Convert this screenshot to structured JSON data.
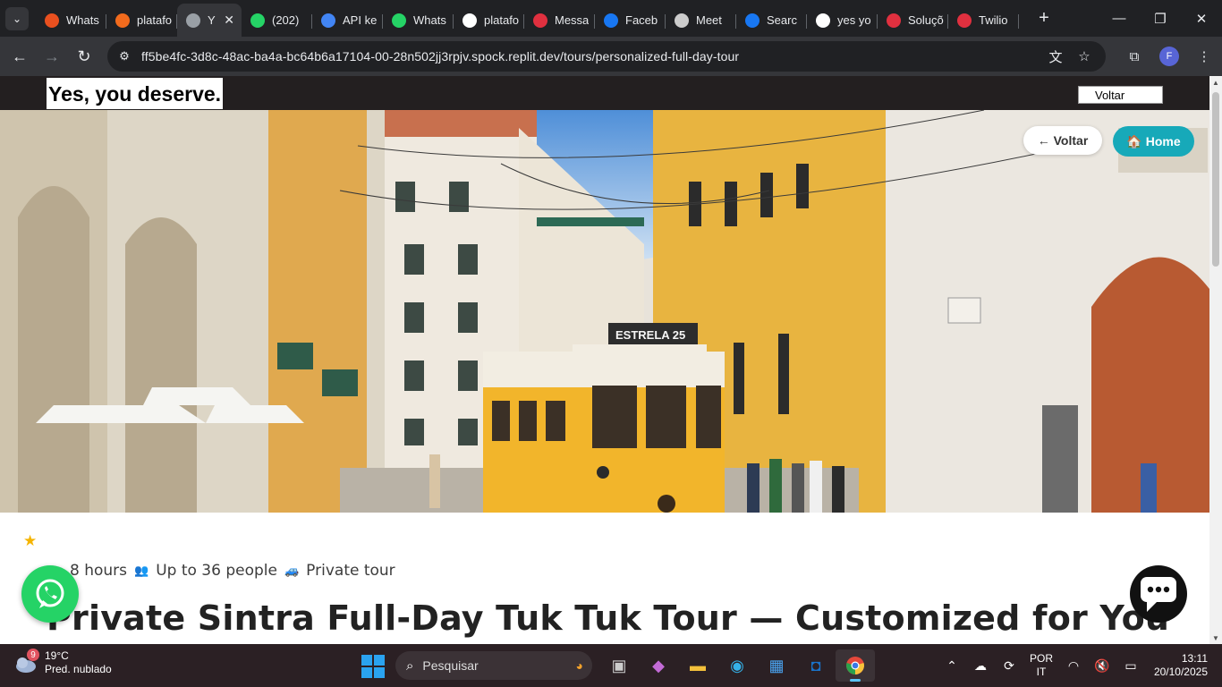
{
  "browser": {
    "tabs": [
      {
        "title": "Whats",
        "favicon": "red-circle-icon",
        "color": "#e9501f"
      },
      {
        "title": "platafo",
        "favicon": "orange-grid-icon",
        "color": "#f26b1d"
      },
      {
        "title": "Y",
        "favicon": "globe-icon",
        "color": "#9aa0a6",
        "active": true
      },
      {
        "title": "(202)",
        "favicon": "whatsapp-icon",
        "color": "#25d366"
      },
      {
        "title": "API ke",
        "favicon": "blue-circle-icon",
        "color": "#4285f4"
      },
      {
        "title": "Whats",
        "favicon": "whatsapp-icon",
        "color": "#25d366"
      },
      {
        "title": "platafo",
        "favicon": "github-icon",
        "color": "#ffffff"
      },
      {
        "title": "Messa",
        "favicon": "twilio-icon",
        "color": "#e0303f"
      },
      {
        "title": "Faceb",
        "favicon": "facebook-icon",
        "color": "#1877f2"
      },
      {
        "title": "Meet",
        "favicon": "meet-icon",
        "color": "#cccccc"
      },
      {
        "title": "Searc",
        "favicon": "facebook-icon",
        "color": "#1877f2"
      },
      {
        "title": "yes yo",
        "favicon": "google-icon",
        "color": "#ffffff"
      },
      {
        "title": "Soluçõ",
        "favicon": "twilio-icon",
        "color": "#e0303f"
      },
      {
        "title": "Twilio",
        "favicon": "twilio-icon",
        "color": "#e0303f"
      }
    ],
    "url": "ff5be4fc-3d8c-48ac-ba4a-bc64b6a17104-00-28n502jj3rpjv.spock.replit.dev/tours/personalized-full-day-tour",
    "profile_initial": "F"
  },
  "site": {
    "brand": "Yes, you deserve.",
    "header_mini": "Voltar",
    "voltar_label": "← Voltar",
    "home_label": "🏠 Home",
    "tram_sign": "ESTRELA 25",
    "tour": {
      "duration": "8 hours",
      "group": "Up to 36 people",
      "type": "Private tour",
      "title": "Private Sintra Full-Day Tuk Tuk Tour — Customized for You"
    }
  },
  "taskbar": {
    "weather_badge": "9",
    "temp": "19°C",
    "condition": "Pred. nublado",
    "search_placeholder": "Pesquisar",
    "lang_line1": "POR",
    "lang_line2": "IT",
    "time": "13:11",
    "date": "20/10/2025"
  },
  "colors": {
    "accent_home": "#17a9b9",
    "whatsapp": "#25d366",
    "tram_yellow": "#f2b52b"
  }
}
